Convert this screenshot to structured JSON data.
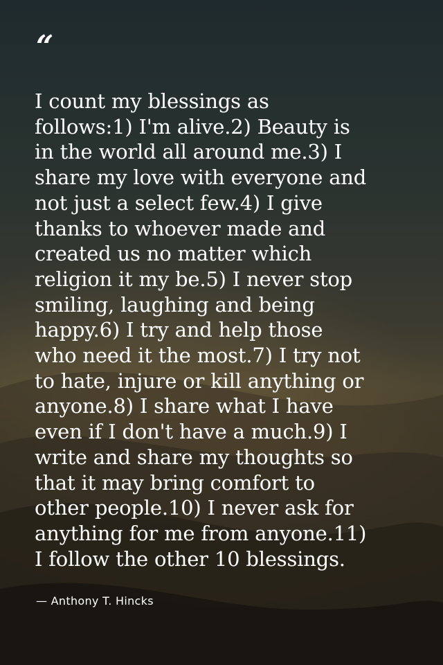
{
  "quote": {
    "mark": "“",
    "lines": [
      "I count my blessings as",
      "follows:1) I'm alive.2) Beauty is",
      "in the world all around me.3) I",
      "share my love with everyone and",
      "not just a select few.4) I give",
      "thanks to whoever made and",
      "created us no matter which",
      "religion it my be.5) I never stop",
      "smiling, laughing and being",
      "happy.6) I try and help those",
      "who need it the most.7) I try not",
      "to hate, injure or kill anything or",
      "anyone.8) I share what I have",
      "even if I don't have a much.9) I",
      "write and share my thoughts so",
      "that it may bring comfort to",
      "other people.10) I never ask for",
      "anything for me from anyone.11)",
      "I follow the other 10 blessings."
    ],
    "author": "— Anthony T. Hincks"
  },
  "colors": {
    "text": "#ffffff",
    "background_top": "#1f2a2e",
    "background_bottom": "#15130f"
  }
}
